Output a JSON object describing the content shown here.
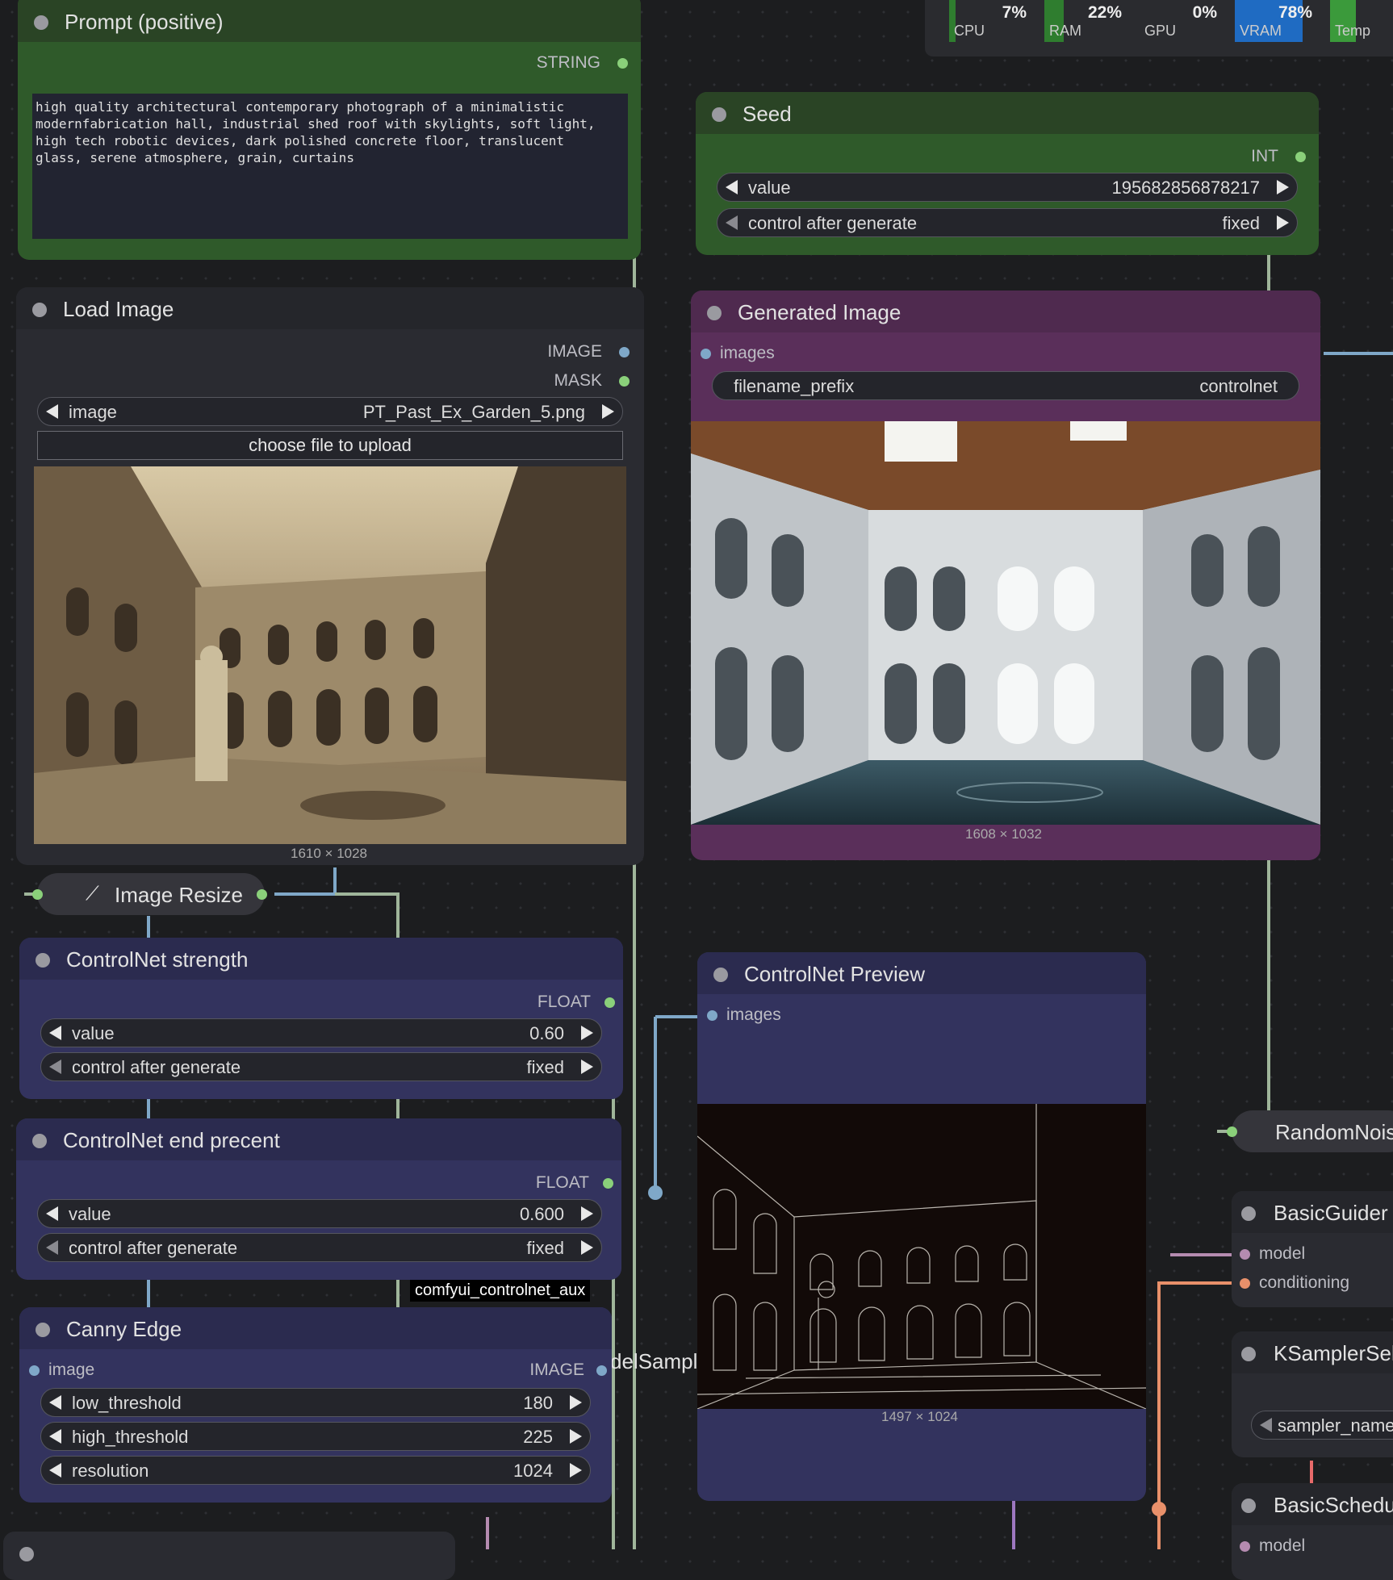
{
  "resource_monitor": [
    {
      "label": "CPU",
      "percent": "7%",
      "fill": 0.07,
      "color": "#2f7d2f"
    },
    {
      "label": "RAM",
      "percent": "22%",
      "fill": 0.22,
      "color": "#2f7d2f"
    },
    {
      "label": "GPU",
      "percent": "0%",
      "fill": 0.0,
      "color": "#2f7d2f"
    },
    {
      "label": "VRAM",
      "percent": "78%",
      "fill": 0.78,
      "color": "#1f6bc2"
    },
    {
      "label": "Temp",
      "percent": "",
      "fill": 0.3,
      "color": "#3b9a3b"
    }
  ],
  "prompt_node": {
    "title": "Prompt (positive)",
    "output": "STRING",
    "text": "high quality architectural contemporary photograph of a minimalistic\nmodernfabrication hall, industrial shed roof with skylights, soft light,\nhigh tech robotic devices, dark polished concrete floor, translucent\nglass, serene atmosphere, grain, curtains"
  },
  "seed_node": {
    "title": "Seed",
    "output": "INT",
    "value_label": "value",
    "value": "195682856878217",
    "control_label": "control after generate",
    "control_value": "fixed"
  },
  "load_image_node": {
    "title": "Load Image",
    "outputs": [
      "IMAGE",
      "MASK"
    ],
    "image_label": "image",
    "image_value": "PT_Past_Ex_Garden_5.png",
    "upload_label": "choose file to upload",
    "size": "1610 × 1028"
  },
  "generated_image_node": {
    "title": "Generated Image",
    "input": "images",
    "prefix_label": "filename_prefix",
    "prefix_value": "controlnet",
    "size": "1608 × 1032"
  },
  "image_resize_node": {
    "title": "Image Resize"
  },
  "cn_strength_node": {
    "title": "ControlNet strength",
    "output": "FLOAT",
    "value_label": "value",
    "value": "0.60",
    "control_label": "control after generate",
    "control_value": "fixed"
  },
  "cn_end_node": {
    "title": "ControlNet end precent",
    "output": "FLOAT",
    "value_label": "value",
    "value": "0.600",
    "control_label": "control after generate",
    "control_value": "fixed"
  },
  "canny_node": {
    "badge": "comfyui_controlnet_aux",
    "title": "Canny Edge",
    "input": "image",
    "output": "IMAGE",
    "low_label": "low_threshold",
    "low_value": "180",
    "high_label": "high_threshold",
    "high_value": "225",
    "res_label": "resolution",
    "res_value": "1024"
  },
  "cn_preview_node": {
    "title": "ControlNet Preview",
    "input": "images",
    "size": "1497 × 1024"
  },
  "partial_texts": {
    "model_sampling": "delSampl"
  },
  "right_nodes": {
    "random_noise": "RandomNois",
    "basic_guider": "BasicGuider",
    "bg_model": "model",
    "bg_conditioning": "conditioning",
    "ksampler_select": "KSamplerSel",
    "ks_sampler": "sampler_name",
    "basic_scheduler": "BasicSchedu",
    "bs_model": "model"
  },
  "colors": {
    "green_node": "#2f5a2a",
    "purple_node": "#5a2f5a",
    "blue_node": "#33335e",
    "dark_node": "#2a2b31"
  }
}
